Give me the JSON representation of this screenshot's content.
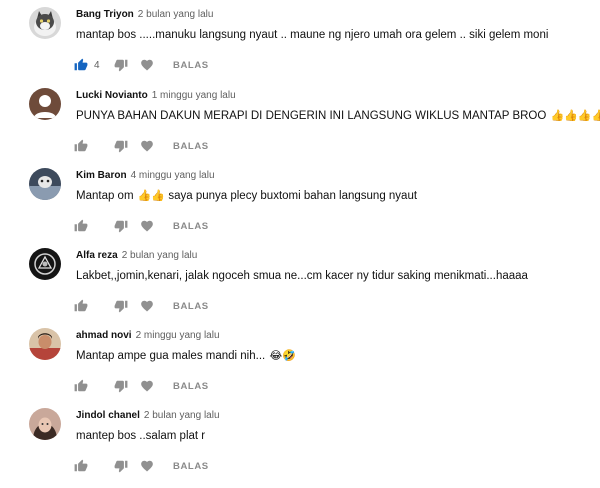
{
  "comments": [
    {
      "author": "Bang Triyon",
      "time": "2 bulan yang lalu",
      "text": "mantap bos .....manuku langsung nyaut .. maune ng njero umah ora gelem .. siki gelem moni",
      "emoji": "",
      "likes": "4",
      "liked": true,
      "reply_label": "BALAS",
      "avatar": {
        "icon": "cat-avatar-icon",
        "color": "#7a7a7a"
      }
    },
    {
      "author": "Lucki Novianto",
      "time": "1 minggu yang lalu",
      "text": "PUNYA BAHAN DAKUN MERAPI DI DENGERIN INI LANGSUNG WIKLUS MANTAP BROO ",
      "emoji": "👍👍👍👍👍",
      "likes": "",
      "liked": false,
      "reply_label": "BALAS",
      "avatar": {
        "icon": "person-silhouette-icon",
        "color": "#6e4b3a"
      }
    },
    {
      "author": "Kim Baron",
      "time": "4 minggu yang lalu",
      "text": "saya punya plecy buxtomi bahan langsung nyaut",
      "text_prefix": "Mantap om ",
      "emoji": "👍👍",
      "likes": "",
      "liked": false,
      "reply_label": "BALAS",
      "avatar": {
        "icon": "photo-avatar-icon",
        "color": "#3d4a5c"
      }
    },
    {
      "author": "Alfa reza",
      "time": "2 bulan yang lalu",
      "text": "Lakbet,,jomin,kenari, jalak ngoceh smua ne...cm kacer ny tidur saking menikmati...haaaa",
      "emoji": "",
      "likes": "",
      "liked": false,
      "reply_label": "BALAS",
      "avatar": {
        "icon": "dark-logo-avatar-icon",
        "color": "#141414"
      }
    },
    {
      "author": "ahmad novi",
      "time": "2 minggu yang lalu",
      "text": "Mantap ampe gua males mandi nih... ",
      "emoji": "😂🤣",
      "likes": "",
      "liked": false,
      "reply_label": "BALAS",
      "avatar": {
        "icon": "person-photo-avatar-icon",
        "color": "#b5443a"
      }
    },
    {
      "author": "Jindol chanel",
      "time": "2 bulan yang lalu",
      "text": "mantep bos ..salam plat r",
      "emoji": "",
      "likes": "",
      "liked": false,
      "reply_label": "BALAS",
      "avatar": {
        "icon": "face-photo-avatar-icon",
        "color": "#c9a89a"
      }
    }
  ],
  "colors": {
    "like_active": "#1565c0",
    "icon_inactive": "#909090",
    "secondary_text": "#606060"
  }
}
